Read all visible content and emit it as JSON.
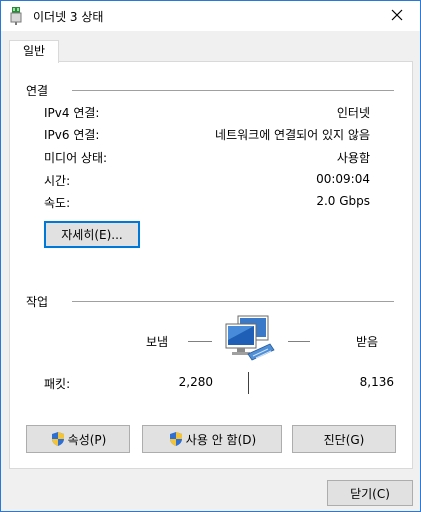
{
  "window": {
    "title": "이더넷 3 상태"
  },
  "tabs": [
    {
      "label": "일반"
    }
  ],
  "connection": {
    "group_label": "연결",
    "rows": [
      {
        "label": "IPv4 연결:",
        "value": "인터넷"
      },
      {
        "label": "IPv6 연결:",
        "value": "네트워크에 연결되어 있지 않음"
      },
      {
        "label": "미디어 상태:",
        "value": "사용함"
      },
      {
        "label": "시간:",
        "value": "00:09:04"
      },
      {
        "label": "속도:",
        "value": "2.0 Gbps"
      }
    ],
    "details_button": "자세히(E)..."
  },
  "activity": {
    "group_label": "작업",
    "sent_label": "보냄",
    "received_label": "받음",
    "packets_label": "패킷:",
    "packets_sent": "2,280",
    "packets_received": "8,136"
  },
  "buttons": {
    "properties": "속성(P)",
    "disable": "사용 안 함(D)",
    "diagnose": "진단(G)",
    "close": "닫기(C)"
  },
  "icons": {
    "title": "network-adapter-icon",
    "close": "close-icon",
    "activity": "network-computers-icon",
    "shield": "uac-shield-icon"
  }
}
